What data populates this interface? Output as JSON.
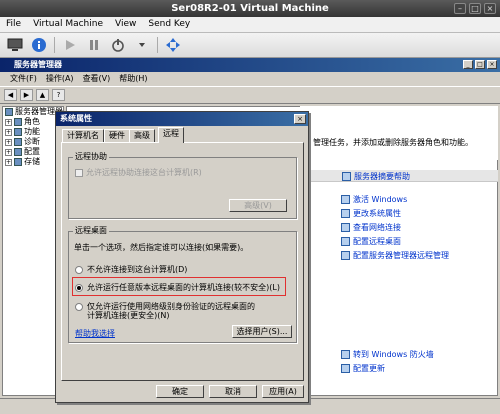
{
  "host": {
    "title": "Ser08R2-01 Virtual Machine",
    "menu": [
      "File",
      "Virtual Machine",
      "View",
      "Send Key"
    ]
  },
  "server_manager": {
    "title": "服务器管理器",
    "menu": [
      "文件(F)",
      "操作(A)",
      "查看(V)",
      "帮助(H)"
    ],
    "tree": [
      {
        "label": "服务器管理器",
        "expander": ""
      },
      {
        "label": "角色",
        "expander": "+"
      },
      {
        "label": "功能",
        "expander": "+"
      },
      {
        "label": "诊断",
        "expander": "+"
      },
      {
        "label": "配置",
        "expander": "+"
      },
      {
        "label": "存储",
        "expander": "+"
      }
    ],
    "banner_text": "管理任务，并添加或删除服务器角色和功能。",
    "section_header": "服务器摘要帮助",
    "links": [
      "激活 Windows",
      "更改系统属性",
      "查看网络连接",
      "配置远程桌面",
      "配置服务器管理器远程管理"
    ],
    "links_bottom": [
      "转到 Windows 防火墙",
      "配置更新"
    ]
  },
  "dialog": {
    "title": "系统属性",
    "close": "×",
    "tabs": [
      "计算机名",
      "硬件",
      "高级",
      "远程"
    ],
    "active_tab": 3,
    "remote_assistance": {
      "group_label": "远程协助",
      "checkbox_label": "允许远程协助连接这台计算机(R)",
      "advanced_button": "高级(V)"
    },
    "remote_desktop": {
      "group_label": "远程桌面",
      "instruction": "单击一个选项，然后指定谁可以连接(如果需要)。",
      "options": [
        "不允许连接到这台计算机(D)",
        "允许运行任意版本远程桌面的计算机连接(较不安全)(L)",
        "仅允许运行使用网络级别身份验证的远程桌面的计算机连接(更安全)(N)"
      ],
      "selected_option": 1,
      "help_link": "帮助我选择",
      "select_users_button": "选择用户(S)..."
    },
    "buttons": {
      "ok": "确定",
      "cancel": "取消",
      "apply": "应用(A)"
    }
  }
}
